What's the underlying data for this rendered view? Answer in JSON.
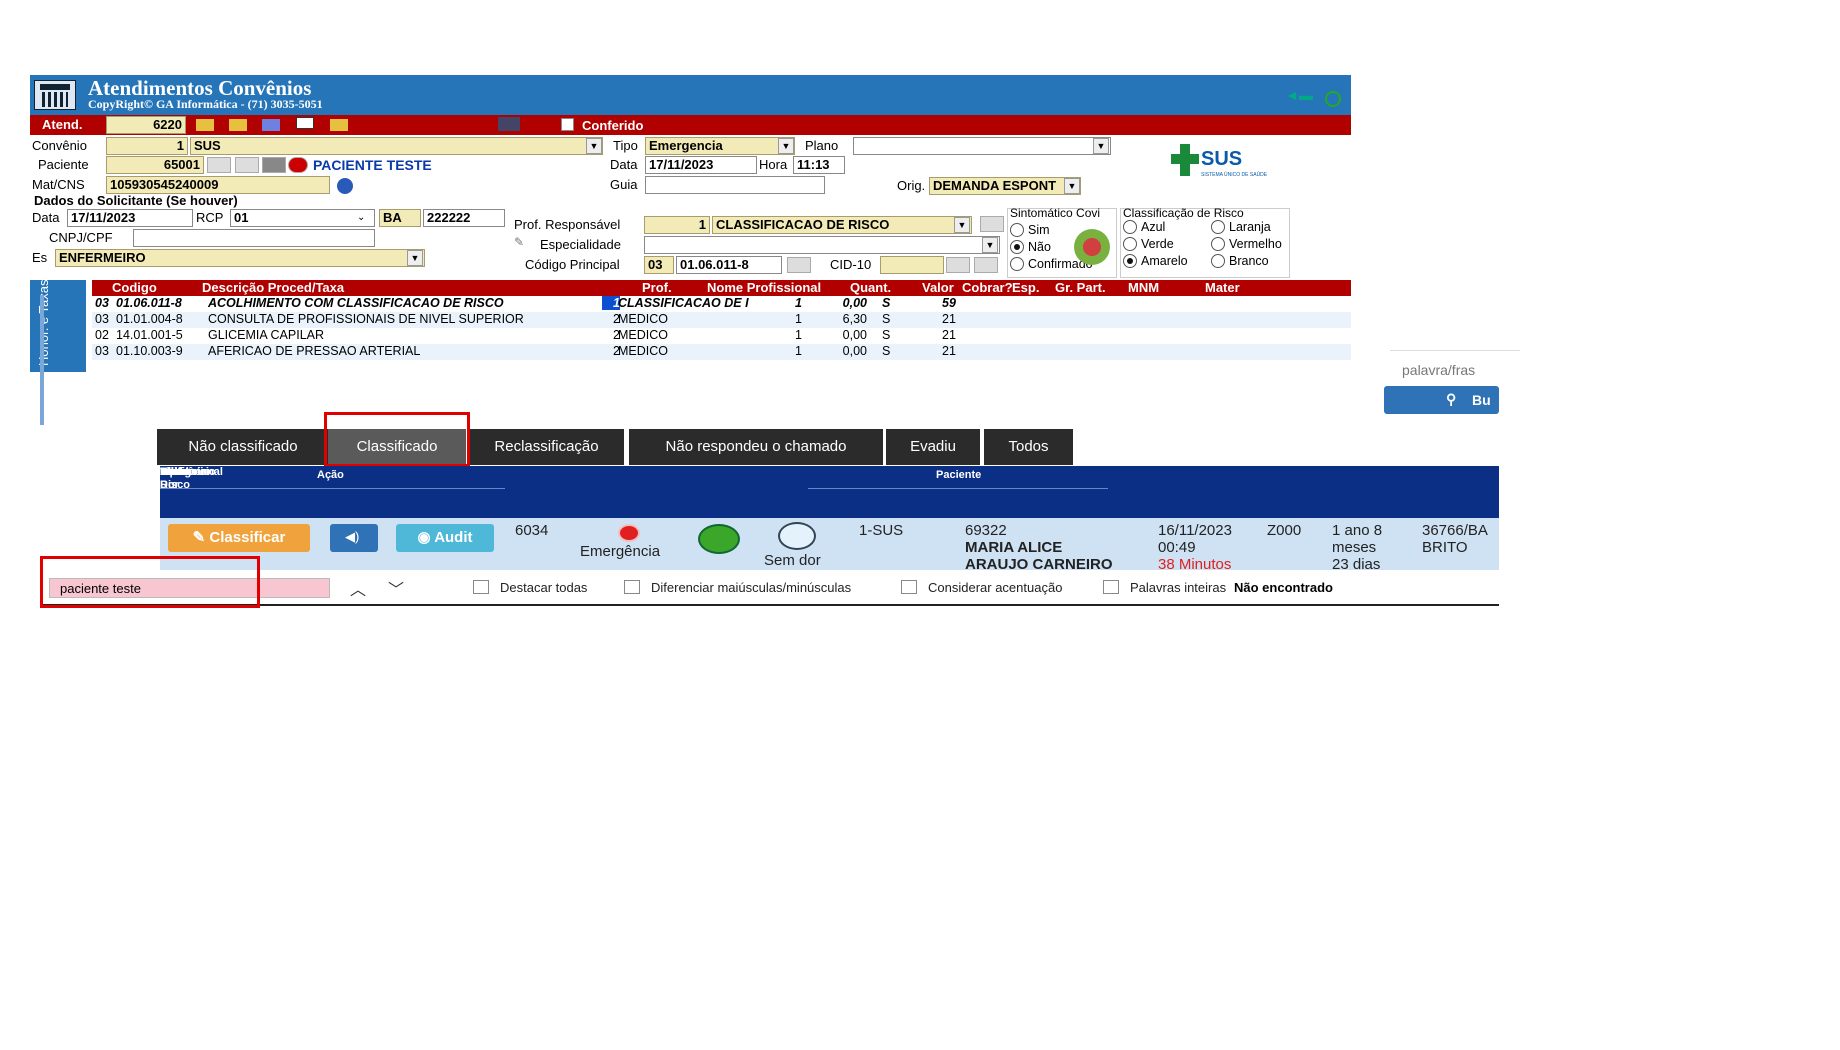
{
  "app": {
    "title": "Atendimentos Convênios",
    "copyright": "CopyRight© GA Informática - (71) 3035-5051"
  },
  "atend": {
    "label": "Atend.",
    "value": "6220",
    "conferido_label": "Conferido"
  },
  "convenio": {
    "label": "Convênio",
    "code": "1",
    "name": "SUS"
  },
  "tipo": {
    "label": "Tipo",
    "value": "Emergencia"
  },
  "plano": {
    "label": "Plano",
    "value": ""
  },
  "paciente": {
    "label": "Paciente",
    "code": "65001",
    "name": "PACIENTE TESTE"
  },
  "data_hora": {
    "data_label": "Data",
    "data": "17/11/2023",
    "hora_label": "Hora",
    "hora": "11:13"
  },
  "mat": {
    "label": "Mat/CNS",
    "value": "105930545240009"
  },
  "guia": {
    "label": "Guia",
    "value": ""
  },
  "orig": {
    "label": "Orig.",
    "value": "DEMANDA ESPONT"
  },
  "logo": {
    "text": "SUS",
    "subtext": "SISTEMA ÚNICO DE SAÚDE"
  },
  "solicitante": {
    "title": "Dados do Solicitante (Se houver)",
    "data_label": "Data",
    "data": "17/11/2023",
    "rcp_label": "RCP",
    "rcp": "01",
    "uf": "BA",
    "num": "222222",
    "cnpj_label": "CNPJ/CPF",
    "cnpj": "",
    "esp_label": "Es",
    "esp": "ENFERMEIRO"
  },
  "prof": {
    "resp_label": "Prof. Responsável",
    "resp_code": "1",
    "resp_name": "CLASSIFICACAO DE RISCO",
    "espec_label": "Especialidade",
    "espec": "",
    "cod_label": "Código Principal",
    "cod_prefix": "03",
    "cod": "01.06.011-8",
    "cid_label": "CID-10",
    "cid": ""
  },
  "covid": {
    "title": "Sintomático Covi",
    "options": [
      "Sim",
      "Não",
      "Confirmado"
    ],
    "selected": "Não"
  },
  "risco": {
    "title": "Classificação de Risco",
    "options": [
      "Azul",
      "Laranja",
      "Verde",
      "Vermelho",
      "Amarelo",
      "Branco"
    ],
    "selected": "Amarelo"
  },
  "side_tab": "Honor. e Taxas",
  "grid": {
    "headers": [
      "Codigo",
      "Descrição Proced/Taxa",
      "Prof.",
      "Nome Profissional",
      "Quant.",
      "Valor",
      "Cobrar?",
      "Esp.",
      "Gr. Part.",
      "MNM",
      "Mater"
    ],
    "rows": [
      [
        "03",
        "01.06.011-8",
        "ACOLHIMENTO COM CLASSIFICACAO DE RISCO",
        "1",
        "CLASSIFICACAO DE I",
        "1",
        "0,00",
        "S",
        "59"
      ],
      [
        "03",
        "01.01.004-8",
        "CONSULTA DE PROFISSIONAIS DE NIVEL SUPERIOR",
        "2",
        "MEDICO",
        "1",
        "6,30",
        "S",
        "21"
      ],
      [
        "02",
        "14.01.001-5",
        "GLICEMIA CAPILAR",
        "2",
        "MEDICO",
        "1",
        "0,00",
        "S",
        "21"
      ],
      [
        "03",
        "01.10.003-9",
        "AFERICAO DE PRESSAO ARTERIAL",
        "2",
        "MEDICO",
        "1",
        "0,00",
        "S",
        "21"
      ]
    ]
  },
  "search": {
    "placeholder": "palavra/fras",
    "button": "Bu"
  },
  "tabs": [
    "Não classificado",
    "Classificado",
    "Reclassificação",
    "Não respondeu o chamado",
    "Evadiu",
    "Todos"
  ],
  "active_tab": "Classificado",
  "table": {
    "group_acao": "Ação",
    "group_paciente": "Paciente",
    "headers": [
      "Edita",
      "Som",
      "Autor",
      "Código",
      "Tipo",
      "Class. Risco",
      "Escala Dor",
      "Convênio",
      "*",
      "Prontuário",
      "Data",
      "Cid",
      "Idade",
      "Profissional"
    ],
    "row": {
      "classificar": "Classificar",
      "audit": "Audit",
      "codigo": "6034",
      "tipo": "Emergência",
      "escala": "Sem dor",
      "convenio": "1-SUS",
      "prontuario": "69322",
      "nome": "MARIA ALICE",
      "nome2": "ARAUJO CARNEIRO",
      "data": "16/11/2023",
      "hora": "00:49",
      "tempo": "38 Minutos",
      "cid": "Z000",
      "idade1": "1 ano 8",
      "idade2": "meses",
      "idade3": "23 dias",
      "prof1": "36766/BA",
      "prof2": "BRITO"
    }
  },
  "findbar": {
    "query": "paciente teste",
    "options": [
      "Destacar todas",
      "Diferenciar maiúsculas/minúsculas",
      "Considerar acentuação",
      "Palavras inteiras"
    ],
    "status": "Não encontrado"
  },
  "colors": {
    "titlebar": "#2675b8",
    "red": "#b00000",
    "field": "#f3ebb7",
    "navy": "#0c2f86",
    "highlight": "#e00000"
  }
}
